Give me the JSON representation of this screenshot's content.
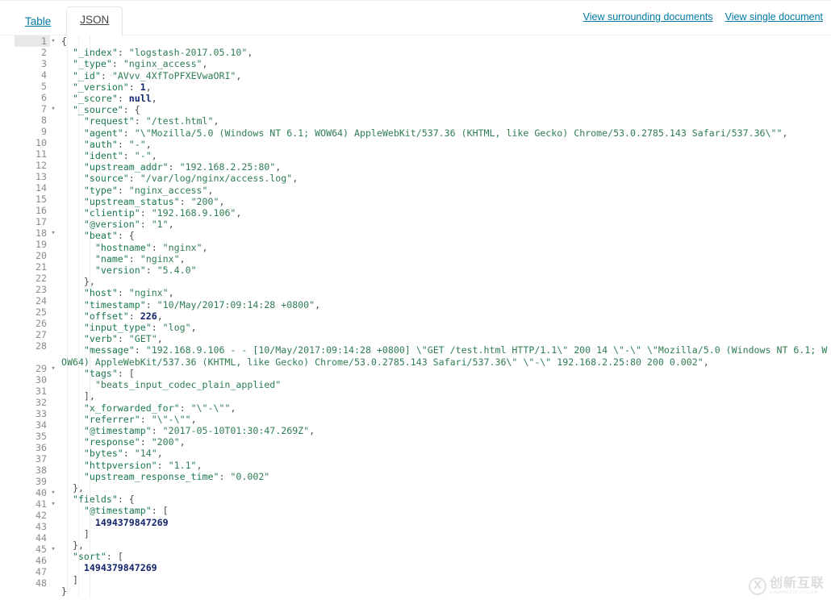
{
  "tabs": [
    {
      "label": "Table",
      "active": false,
      "name": "tab-table"
    },
    {
      "label": "JSON",
      "active": true,
      "name": "tab-json"
    }
  ],
  "toolbar": {
    "view_surrounding_label": "View surrounding documents",
    "view_single_label": "View single document"
  },
  "colors": {
    "link": "#0079a5",
    "key": "#1a7a4c",
    "string": "#2f7d52",
    "number": "#12246b",
    "active_line_gutter": "#e8e8e8"
  },
  "editor": {
    "total_lines": 48,
    "active_line": 1,
    "fold_lines": [
      1,
      7,
      18,
      29,
      40,
      41,
      45
    ],
    "lines": [
      {
        "no": 1,
        "indent": 0,
        "tokens": [
          [
            "p",
            "{"
          ]
        ]
      },
      {
        "no": 2,
        "indent": 1,
        "tokens": [
          [
            "k",
            "\"_index\""
          ],
          [
            "p",
            ": "
          ],
          [
            "s",
            "\"logstash-2017.05.10\""
          ],
          [
            "p",
            ","
          ]
        ]
      },
      {
        "no": 3,
        "indent": 1,
        "tokens": [
          [
            "k",
            "\"_type\""
          ],
          [
            "p",
            ": "
          ],
          [
            "s",
            "\"nginx_access\""
          ],
          [
            "p",
            ","
          ]
        ]
      },
      {
        "no": 4,
        "indent": 1,
        "tokens": [
          [
            "k",
            "\"_id\""
          ],
          [
            "p",
            ": "
          ],
          [
            "s",
            "\"AVvv_4XfToPFXEVwaORI\""
          ],
          [
            "p",
            ","
          ]
        ]
      },
      {
        "no": 5,
        "indent": 1,
        "tokens": [
          [
            "k",
            "\"_version\""
          ],
          [
            "p",
            ": "
          ],
          [
            "n",
            "1"
          ],
          [
            "p",
            ","
          ]
        ]
      },
      {
        "no": 6,
        "indent": 1,
        "tokens": [
          [
            "k",
            "\"_score\""
          ],
          [
            "p",
            ": "
          ],
          [
            "n",
            "null"
          ],
          [
            "p",
            ","
          ]
        ]
      },
      {
        "no": 7,
        "indent": 1,
        "tokens": [
          [
            "k",
            "\"_source\""
          ],
          [
            "p",
            ": "
          ],
          [
            "p",
            "{"
          ]
        ]
      },
      {
        "no": 8,
        "indent": 2,
        "tokens": [
          [
            "k",
            "\"request\""
          ],
          [
            "p",
            ": "
          ],
          [
            "s",
            "\"/test.html\""
          ],
          [
            "p",
            ","
          ]
        ]
      },
      {
        "no": 9,
        "indent": 2,
        "tokens": [
          [
            "k",
            "\"agent\""
          ],
          [
            "p",
            ": "
          ],
          [
            "s",
            "\"\\\"Mozilla/5.0 (Windows NT 6.1; WOW64) AppleWebKit/537.36 (KHTML, like Gecko) Chrome/53.0.2785.143 Safari/537.36\\\"\""
          ],
          [
            "p",
            ","
          ]
        ]
      },
      {
        "no": 10,
        "indent": 2,
        "tokens": [
          [
            "k",
            "\"auth\""
          ],
          [
            "p",
            ": "
          ],
          [
            "s",
            "\"-\""
          ],
          [
            "p",
            ","
          ]
        ]
      },
      {
        "no": 11,
        "indent": 2,
        "tokens": [
          [
            "k",
            "\"ident\""
          ],
          [
            "p",
            ": "
          ],
          [
            "s",
            "\"-\""
          ],
          [
            "p",
            ","
          ]
        ]
      },
      {
        "no": 12,
        "indent": 2,
        "tokens": [
          [
            "k",
            "\"upstream_addr\""
          ],
          [
            "p",
            ": "
          ],
          [
            "s",
            "\"192.168.2.25:80\""
          ],
          [
            "p",
            ","
          ]
        ]
      },
      {
        "no": 13,
        "indent": 2,
        "tokens": [
          [
            "k",
            "\"source\""
          ],
          [
            "p",
            ": "
          ],
          [
            "s",
            "\"/var/log/nginx/access.log\""
          ],
          [
            "p",
            ","
          ]
        ]
      },
      {
        "no": 14,
        "indent": 2,
        "tokens": [
          [
            "k",
            "\"type\""
          ],
          [
            "p",
            ": "
          ],
          [
            "s",
            "\"nginx_access\""
          ],
          [
            "p",
            ","
          ]
        ]
      },
      {
        "no": 15,
        "indent": 2,
        "tokens": [
          [
            "k",
            "\"upstream_status\""
          ],
          [
            "p",
            ": "
          ],
          [
            "s",
            "\"200\""
          ],
          [
            "p",
            ","
          ]
        ]
      },
      {
        "no": 16,
        "indent": 2,
        "tokens": [
          [
            "k",
            "\"clientip\""
          ],
          [
            "p",
            ": "
          ],
          [
            "s",
            "\"192.168.9.106\""
          ],
          [
            "p",
            ","
          ]
        ]
      },
      {
        "no": 17,
        "indent": 2,
        "tokens": [
          [
            "k",
            "\"@version\""
          ],
          [
            "p",
            ": "
          ],
          [
            "s",
            "\"1\""
          ],
          [
            "p",
            ","
          ]
        ]
      },
      {
        "no": 18,
        "indent": 2,
        "tokens": [
          [
            "k",
            "\"beat\""
          ],
          [
            "p",
            ": "
          ],
          [
            "p",
            "{"
          ]
        ]
      },
      {
        "no": 19,
        "indent": 3,
        "tokens": [
          [
            "k",
            "\"hostname\""
          ],
          [
            "p",
            ": "
          ],
          [
            "s",
            "\"nginx\""
          ],
          [
            "p",
            ","
          ]
        ]
      },
      {
        "no": 20,
        "indent": 3,
        "tokens": [
          [
            "k",
            "\"name\""
          ],
          [
            "p",
            ": "
          ],
          [
            "s",
            "\"nginx\""
          ],
          [
            "p",
            ","
          ]
        ]
      },
      {
        "no": 21,
        "indent": 3,
        "tokens": [
          [
            "k",
            "\"version\""
          ],
          [
            "p",
            ": "
          ],
          [
            "s",
            "\"5.4.0\""
          ]
        ]
      },
      {
        "no": 22,
        "indent": 2,
        "tokens": [
          [
            "p",
            "},"
          ]
        ]
      },
      {
        "no": 23,
        "indent": 2,
        "tokens": [
          [
            "k",
            "\"host\""
          ],
          [
            "p",
            ": "
          ],
          [
            "s",
            "\"nginx\""
          ],
          [
            "p",
            ","
          ]
        ]
      },
      {
        "no": 24,
        "indent": 2,
        "tokens": [
          [
            "k",
            "\"timestamp\""
          ],
          [
            "p",
            ": "
          ],
          [
            "s",
            "\"10/May/2017:09:14:28 +0800\""
          ],
          [
            "p",
            ","
          ]
        ]
      },
      {
        "no": 25,
        "indent": 2,
        "tokens": [
          [
            "k",
            "\"offset\""
          ],
          [
            "p",
            ": "
          ],
          [
            "n",
            "226"
          ],
          [
            "p",
            ","
          ]
        ]
      },
      {
        "no": 26,
        "indent": 2,
        "tokens": [
          [
            "k",
            "\"input_type\""
          ],
          [
            "p",
            ": "
          ],
          [
            "s",
            "\"log\""
          ],
          [
            "p",
            ","
          ]
        ]
      },
      {
        "no": 27,
        "indent": 2,
        "tokens": [
          [
            "k",
            "\"verb\""
          ],
          [
            "p",
            ": "
          ],
          [
            "s",
            "\"GET\""
          ],
          [
            "p",
            ","
          ]
        ]
      },
      {
        "no": 28,
        "indent": 2,
        "tokens": [
          [
            "k",
            "\"message\""
          ],
          [
            "p",
            ": "
          ],
          [
            "s",
            "\"192.168.9.106 - - [10/May/2017:09:14:28 +0800] \\\"GET /test.html HTTP/1.1\\\" 200 14 \\\"-\\\" \\\"Mozilla/5.0 (Windows NT 6.1; WOW64) AppleWebKit/537.36 (KHTML, like Gecko) Chrome/53.0.2785.143 Safari/537.36\\\" \\\"-\\\" 192.168.2.25:80 200 0.002\""
          ],
          [
            "p",
            ","
          ]
        ]
      },
      {
        "no": 29,
        "indent": 2,
        "tokens": [
          [
            "k",
            "\"tags\""
          ],
          [
            "p",
            ": "
          ],
          [
            "p",
            "["
          ]
        ]
      },
      {
        "no": 30,
        "indent": 3,
        "tokens": [
          [
            "s",
            "\"beats_input_codec_plain_applied\""
          ]
        ]
      },
      {
        "no": 31,
        "indent": 2,
        "tokens": [
          [
            "p",
            "],"
          ]
        ]
      },
      {
        "no": 32,
        "indent": 2,
        "tokens": [
          [
            "k",
            "\"x_forwarded_for\""
          ],
          [
            "p",
            ": "
          ],
          [
            "s",
            "\"\\\"-\\\"\""
          ],
          [
            "p",
            ","
          ]
        ]
      },
      {
        "no": 33,
        "indent": 2,
        "tokens": [
          [
            "k",
            "\"referrer\""
          ],
          [
            "p",
            ": "
          ],
          [
            "s",
            "\"\\\"-\\\"\""
          ],
          [
            "p",
            ","
          ]
        ]
      },
      {
        "no": 34,
        "indent": 2,
        "tokens": [
          [
            "k",
            "\"@timestamp\""
          ],
          [
            "p",
            ": "
          ],
          [
            "s",
            "\"2017-05-10T01:30:47.269Z\""
          ],
          [
            "p",
            ","
          ]
        ]
      },
      {
        "no": 35,
        "indent": 2,
        "tokens": [
          [
            "k",
            "\"response\""
          ],
          [
            "p",
            ": "
          ],
          [
            "s",
            "\"200\""
          ],
          [
            "p",
            ","
          ]
        ]
      },
      {
        "no": 36,
        "indent": 2,
        "tokens": [
          [
            "k",
            "\"bytes\""
          ],
          [
            "p",
            ": "
          ],
          [
            "s",
            "\"14\""
          ],
          [
            "p",
            ","
          ]
        ]
      },
      {
        "no": 37,
        "indent": 2,
        "tokens": [
          [
            "k",
            "\"httpversion\""
          ],
          [
            "p",
            ": "
          ],
          [
            "s",
            "\"1.1\""
          ],
          [
            "p",
            ","
          ]
        ]
      },
      {
        "no": 38,
        "indent": 2,
        "tokens": [
          [
            "k",
            "\"upstream_response_time\""
          ],
          [
            "p",
            ": "
          ],
          [
            "s",
            "\"0.002\""
          ]
        ]
      },
      {
        "no": 39,
        "indent": 1,
        "tokens": [
          [
            "p",
            "},"
          ]
        ]
      },
      {
        "no": 40,
        "indent": 1,
        "tokens": [
          [
            "k",
            "\"fields\""
          ],
          [
            "p",
            ": "
          ],
          [
            "p",
            "{"
          ]
        ]
      },
      {
        "no": 41,
        "indent": 2,
        "tokens": [
          [
            "k",
            "\"@timestamp\""
          ],
          [
            "p",
            ": "
          ],
          [
            "p",
            "["
          ]
        ]
      },
      {
        "no": 42,
        "indent": 3,
        "tokens": [
          [
            "n",
            "1494379847269"
          ]
        ]
      },
      {
        "no": 43,
        "indent": 2,
        "tokens": [
          [
            "p",
            "]"
          ]
        ]
      },
      {
        "no": 44,
        "indent": 1,
        "tokens": [
          [
            "p",
            "},"
          ]
        ]
      },
      {
        "no": 45,
        "indent": 1,
        "tokens": [
          [
            "k",
            "\"sort\""
          ],
          [
            "p",
            ": "
          ],
          [
            "p",
            "["
          ]
        ]
      },
      {
        "no": 46,
        "indent": 2,
        "tokens": [
          [
            "n",
            "1494379847269"
          ]
        ]
      },
      {
        "no": 47,
        "indent": 1,
        "tokens": [
          [
            "p",
            "]"
          ]
        ]
      },
      {
        "no": 48,
        "indent": 0,
        "tokens": [
          [
            "p",
            "}"
          ]
        ]
      }
    ]
  },
  "watermark": {
    "badge": "X",
    "cn": "创新互联",
    "en": "CHUANGXIN HULIAN"
  }
}
